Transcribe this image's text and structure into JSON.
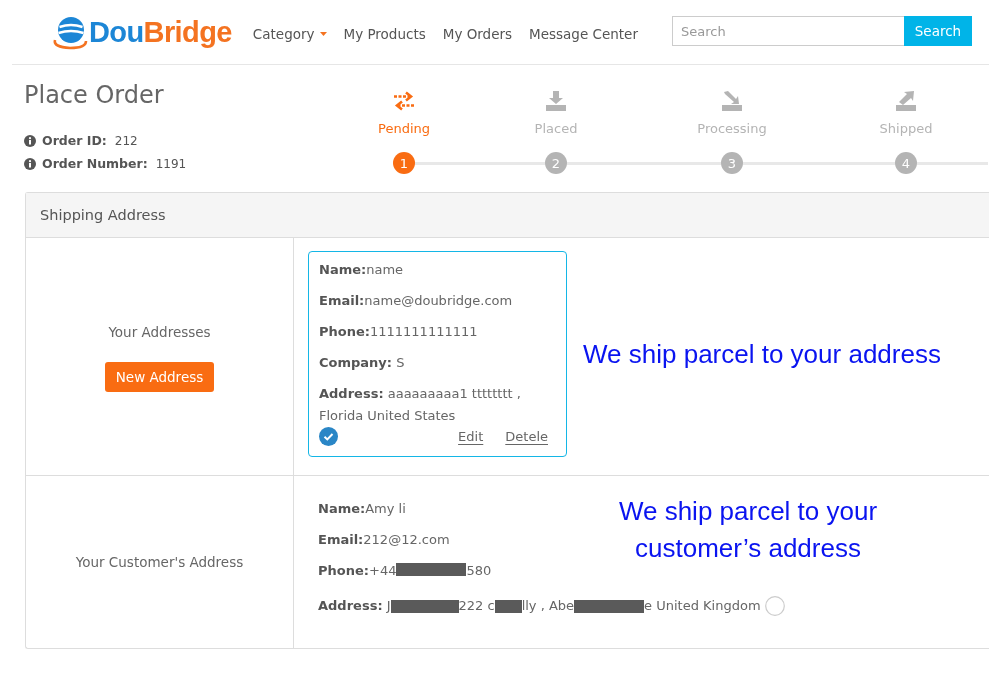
{
  "header": {
    "logo": [
      "Dou",
      "Bridge"
    ],
    "nav": [
      {
        "label": "Category",
        "dropdown": true
      },
      {
        "label": "My Products",
        "dropdown": false
      },
      {
        "label": "My Orders",
        "dropdown": false
      },
      {
        "label": "Message Center",
        "dropdown": false
      }
    ],
    "search": {
      "placeholder": "Search",
      "button": "Search"
    }
  },
  "page_title": "Place Order",
  "order_info": [
    {
      "label": "Order ID:",
      "value": "212"
    },
    {
      "label": "Order Number:",
      "value": "1191"
    }
  ],
  "steps": [
    {
      "label": "Pending",
      "number": "1",
      "selected": true
    },
    {
      "label": "Placed",
      "number": "2",
      "selected": false
    },
    {
      "label": "Processing",
      "number": "3",
      "selected": false
    },
    {
      "label": "Shipped",
      "number": "4",
      "selected": false
    }
  ],
  "shipping_address": {
    "title": "Shipping Address",
    "rows": [
      {
        "kind": "card",
        "label": "Your Addresses",
        "button": "New Address",
        "address": {
          "selected": true,
          "fields": [
            {
              "parts": [
                {
                  "kind": "text",
                  "text": "**Name:**name"
                }
              ]
            },
            {
              "parts": [
                {
                  "kind": "text",
                  "text": "**Email:**name@doubridge.com"
                }
              ]
            },
            {
              "parts": [
                {
                  "kind": "text",
                  "text": "**Phone:**1111111111111"
                }
              ]
            },
            {
              "parts": [
                {
                  "kind": "text",
                  "text": "**Company:** S"
                }
              ]
            },
            {
              "parts": [
                {
                  "kind": "text",
                  "text": "**Address:** aaaaaaaaa1 tttttttt ,"
                },
                {
                  "kind": "break"
                },
                {
                  "kind": "text",
                  "text": "Florida United States"
                }
              ]
            }
          ],
          "actions": [
            "Edit",
            "Detele"
          ]
        },
        "note": [
          "We ship parcel to your address"
        ]
      },
      {
        "kind": "inline",
        "label": "Your Customer's Address",
        "address": {
          "selected": false,
          "fields": [
            {
              "parts": [
                {
                  "kind": "text",
                  "text": "**Name:**Amy li"
                }
              ]
            },
            {
              "parts": [
                {
                  "kind": "text",
                  "text": "**Email:**212@12.com"
                }
              ]
            },
            {
              "parts": [
                {
                  "kind": "text",
                  "text": "**Phone:**+44"
                },
                {
                  "kind": "redacted"
                },
                {
                  "kind": "text",
                  "text": "580"
                }
              ]
            },
            {
              "parts": [
                {
                  "kind": "text",
                  "text": "**Address:** J"
                },
                {
                  "kind": "redacted"
                },
                {
                  "kind": "text",
                  "text": "222 c"
                },
                {
                  "kind": "redacted"
                },
                {
                  "kind": "text",
                  "text": "lly , Abe"
                },
                {
                  "kind": "redacted"
                },
                {
                  "kind": "text",
                  "text": "e United Kingdom"
                }
              ]
            }
          ]
        },
        "note": [
          "We ship parcel to your",
          "customer’s address"
        ]
      }
    ]
  }
}
